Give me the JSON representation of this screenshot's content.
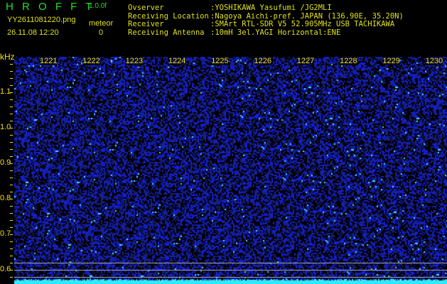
{
  "header": {
    "app_name": "H R O F F T",
    "version": "1.0.0f",
    "filename": "YY2611081220.png",
    "datetime": "26.11.08 12:20",
    "meteor_label": "meteor",
    "meteor_count": "0"
  },
  "info": [
    {
      "label": "Ovserver",
      "value": ":YOSHIKAWA Yasufumi /JG2MLI"
    },
    {
      "label": "Receiving Location",
      "value": ":Nagoya Aichi-pref. JAPAN (136.90E, 35.20N)"
    },
    {
      "label": "Receiver",
      "value": ":SMArt RTL-SDR V5 52.905MHz USB TACHIKAWA"
    },
    {
      "label": "Receiving Antenna",
      "value": ":10mH 3el.YAGI Horizontal:ENE"
    }
  ],
  "spectrogram": {
    "y_unit": "kHz",
    "y_labels": [
      "1.1",
      "1.0",
      "0.9",
      "0.8",
      "0.7",
      "0.6"
    ],
    "time_labels": [
      "1221",
      "1222",
      "1223",
      "1224",
      "1225",
      "1226",
      "1227",
      "1228",
      "1229",
      "1230"
    ]
  },
  "colors": {
    "noise": "#2030e0",
    "signal": "#40e0ff",
    "text": "#f0e020",
    "title": "#22e022"
  }
}
